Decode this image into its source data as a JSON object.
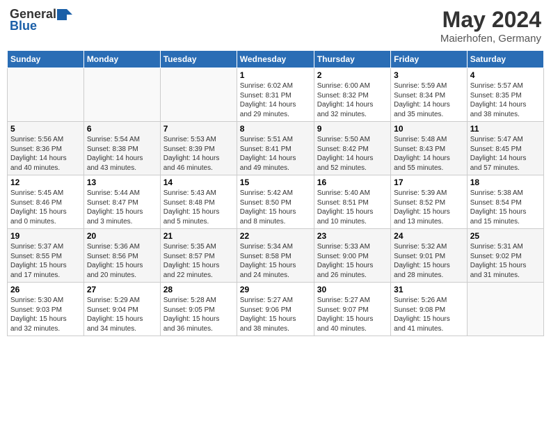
{
  "header": {
    "logo_general": "General",
    "logo_blue": "Blue",
    "month_year": "May 2024",
    "location": "Maierhofen, Germany"
  },
  "days_of_week": [
    "Sunday",
    "Monday",
    "Tuesday",
    "Wednesday",
    "Thursday",
    "Friday",
    "Saturday"
  ],
  "weeks": [
    [
      {
        "day": "",
        "info": ""
      },
      {
        "day": "",
        "info": ""
      },
      {
        "day": "",
        "info": ""
      },
      {
        "day": "1",
        "info": "Sunrise: 6:02 AM\nSunset: 8:31 PM\nDaylight: 14 hours\nand 29 minutes."
      },
      {
        "day": "2",
        "info": "Sunrise: 6:00 AM\nSunset: 8:32 PM\nDaylight: 14 hours\nand 32 minutes."
      },
      {
        "day": "3",
        "info": "Sunrise: 5:59 AM\nSunset: 8:34 PM\nDaylight: 14 hours\nand 35 minutes."
      },
      {
        "day": "4",
        "info": "Sunrise: 5:57 AM\nSunset: 8:35 PM\nDaylight: 14 hours\nand 38 minutes."
      }
    ],
    [
      {
        "day": "5",
        "info": "Sunrise: 5:56 AM\nSunset: 8:36 PM\nDaylight: 14 hours\nand 40 minutes."
      },
      {
        "day": "6",
        "info": "Sunrise: 5:54 AM\nSunset: 8:38 PM\nDaylight: 14 hours\nand 43 minutes."
      },
      {
        "day": "7",
        "info": "Sunrise: 5:53 AM\nSunset: 8:39 PM\nDaylight: 14 hours\nand 46 minutes."
      },
      {
        "day": "8",
        "info": "Sunrise: 5:51 AM\nSunset: 8:41 PM\nDaylight: 14 hours\nand 49 minutes."
      },
      {
        "day": "9",
        "info": "Sunrise: 5:50 AM\nSunset: 8:42 PM\nDaylight: 14 hours\nand 52 minutes."
      },
      {
        "day": "10",
        "info": "Sunrise: 5:48 AM\nSunset: 8:43 PM\nDaylight: 14 hours\nand 55 minutes."
      },
      {
        "day": "11",
        "info": "Sunrise: 5:47 AM\nSunset: 8:45 PM\nDaylight: 14 hours\nand 57 minutes."
      }
    ],
    [
      {
        "day": "12",
        "info": "Sunrise: 5:45 AM\nSunset: 8:46 PM\nDaylight: 15 hours\nand 0 minutes."
      },
      {
        "day": "13",
        "info": "Sunrise: 5:44 AM\nSunset: 8:47 PM\nDaylight: 15 hours\nand 3 minutes."
      },
      {
        "day": "14",
        "info": "Sunrise: 5:43 AM\nSunset: 8:48 PM\nDaylight: 15 hours\nand 5 minutes."
      },
      {
        "day": "15",
        "info": "Sunrise: 5:42 AM\nSunset: 8:50 PM\nDaylight: 15 hours\nand 8 minutes."
      },
      {
        "day": "16",
        "info": "Sunrise: 5:40 AM\nSunset: 8:51 PM\nDaylight: 15 hours\nand 10 minutes."
      },
      {
        "day": "17",
        "info": "Sunrise: 5:39 AM\nSunset: 8:52 PM\nDaylight: 15 hours\nand 13 minutes."
      },
      {
        "day": "18",
        "info": "Sunrise: 5:38 AM\nSunset: 8:54 PM\nDaylight: 15 hours\nand 15 minutes."
      }
    ],
    [
      {
        "day": "19",
        "info": "Sunrise: 5:37 AM\nSunset: 8:55 PM\nDaylight: 15 hours\nand 17 minutes."
      },
      {
        "day": "20",
        "info": "Sunrise: 5:36 AM\nSunset: 8:56 PM\nDaylight: 15 hours\nand 20 minutes."
      },
      {
        "day": "21",
        "info": "Sunrise: 5:35 AM\nSunset: 8:57 PM\nDaylight: 15 hours\nand 22 minutes."
      },
      {
        "day": "22",
        "info": "Sunrise: 5:34 AM\nSunset: 8:58 PM\nDaylight: 15 hours\nand 24 minutes."
      },
      {
        "day": "23",
        "info": "Sunrise: 5:33 AM\nSunset: 9:00 PM\nDaylight: 15 hours\nand 26 minutes."
      },
      {
        "day": "24",
        "info": "Sunrise: 5:32 AM\nSunset: 9:01 PM\nDaylight: 15 hours\nand 28 minutes."
      },
      {
        "day": "25",
        "info": "Sunrise: 5:31 AM\nSunset: 9:02 PM\nDaylight: 15 hours\nand 31 minutes."
      }
    ],
    [
      {
        "day": "26",
        "info": "Sunrise: 5:30 AM\nSunset: 9:03 PM\nDaylight: 15 hours\nand 32 minutes."
      },
      {
        "day": "27",
        "info": "Sunrise: 5:29 AM\nSunset: 9:04 PM\nDaylight: 15 hours\nand 34 minutes."
      },
      {
        "day": "28",
        "info": "Sunrise: 5:28 AM\nSunset: 9:05 PM\nDaylight: 15 hours\nand 36 minutes."
      },
      {
        "day": "29",
        "info": "Sunrise: 5:27 AM\nSunset: 9:06 PM\nDaylight: 15 hours\nand 38 minutes."
      },
      {
        "day": "30",
        "info": "Sunrise: 5:27 AM\nSunset: 9:07 PM\nDaylight: 15 hours\nand 40 minutes."
      },
      {
        "day": "31",
        "info": "Sunrise: 5:26 AM\nSunset: 9:08 PM\nDaylight: 15 hours\nand 41 minutes."
      },
      {
        "day": "",
        "info": ""
      }
    ]
  ]
}
